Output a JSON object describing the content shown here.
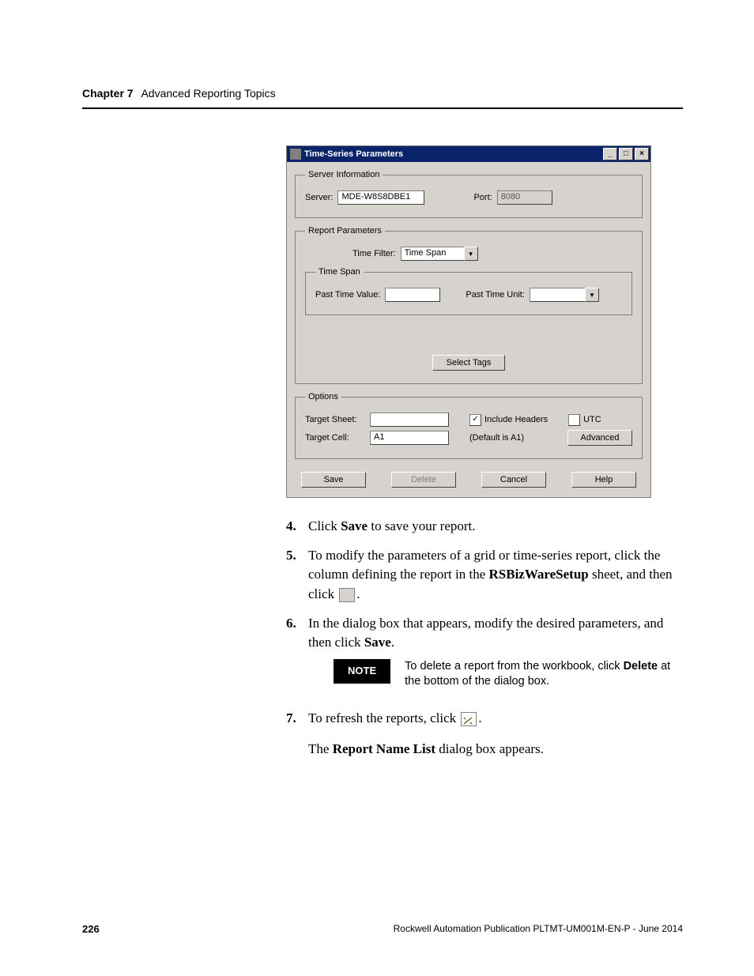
{
  "header": {
    "chapter": "Chapter 7",
    "title": "Advanced Reporting Topics"
  },
  "dialog": {
    "title": "Time-Series Parameters",
    "groups": {
      "server": {
        "legend": "Server Information",
        "server_label": "Server:",
        "server_value": "MDE-W8S8DBE1",
        "port_label": "Port:",
        "port_value": "8080"
      },
      "report": {
        "legend": "Report Parameters",
        "timefilter_label": "Time Filter:",
        "timefilter_value": "Time Span",
        "timespan_legend": "Time Span",
        "pastvalue_label": "Past Time Value:",
        "pastvalue_value": "",
        "pastunit_label": "Past Time Unit:",
        "pastunit_value": "",
        "select_tags": "Select Tags"
      },
      "options": {
        "legend": "Options",
        "target_sheet_label": "Target Sheet:",
        "target_sheet_value": "",
        "include_headers_label": "Include Headers",
        "include_headers_checked": true,
        "utc_label": "UTC",
        "utc_checked": false,
        "target_cell_label": "Target Cell:",
        "target_cell_value": "A1",
        "default_hint": "(Default is A1)",
        "advanced": "Advanced"
      }
    },
    "buttons": {
      "save": "Save",
      "delete": "Delete",
      "cancel": "Cancel",
      "help": "Help"
    }
  },
  "steps": {
    "s4": {
      "num": "4.",
      "pre": "Click ",
      "bold": "Save",
      "post": " to save your report."
    },
    "s5": {
      "num": "5.",
      "line1_pre": "To modify the parameters of a grid or time-series report, click the column defining the report in the ",
      "line1_bold": "RSBizWareSetup",
      "line1_post": " sheet, and then click ",
      "line1_tail": "."
    },
    "s6": {
      "num": "6.",
      "line_pre": "In the dialog box that appears, modify the desired parameters, and then click ",
      "line_bold": "Save",
      "line_post": "."
    },
    "note": {
      "badge": "NOTE",
      "text_pre": "To delete a report from the workbook, click ",
      "text_bold": "Delete",
      "text_post": " at the bottom of the dialog box."
    },
    "s7": {
      "num": "7.",
      "text": "To refresh the reports, click ",
      "tail": "."
    },
    "after7_pre": "The ",
    "after7_bold": "Report Name List",
    "after7_post": " dialog box appears."
  },
  "footer": {
    "page": "226",
    "pub": "Rockwell Automation Publication PLTMT-UM001M-EN-P - June 2014"
  }
}
